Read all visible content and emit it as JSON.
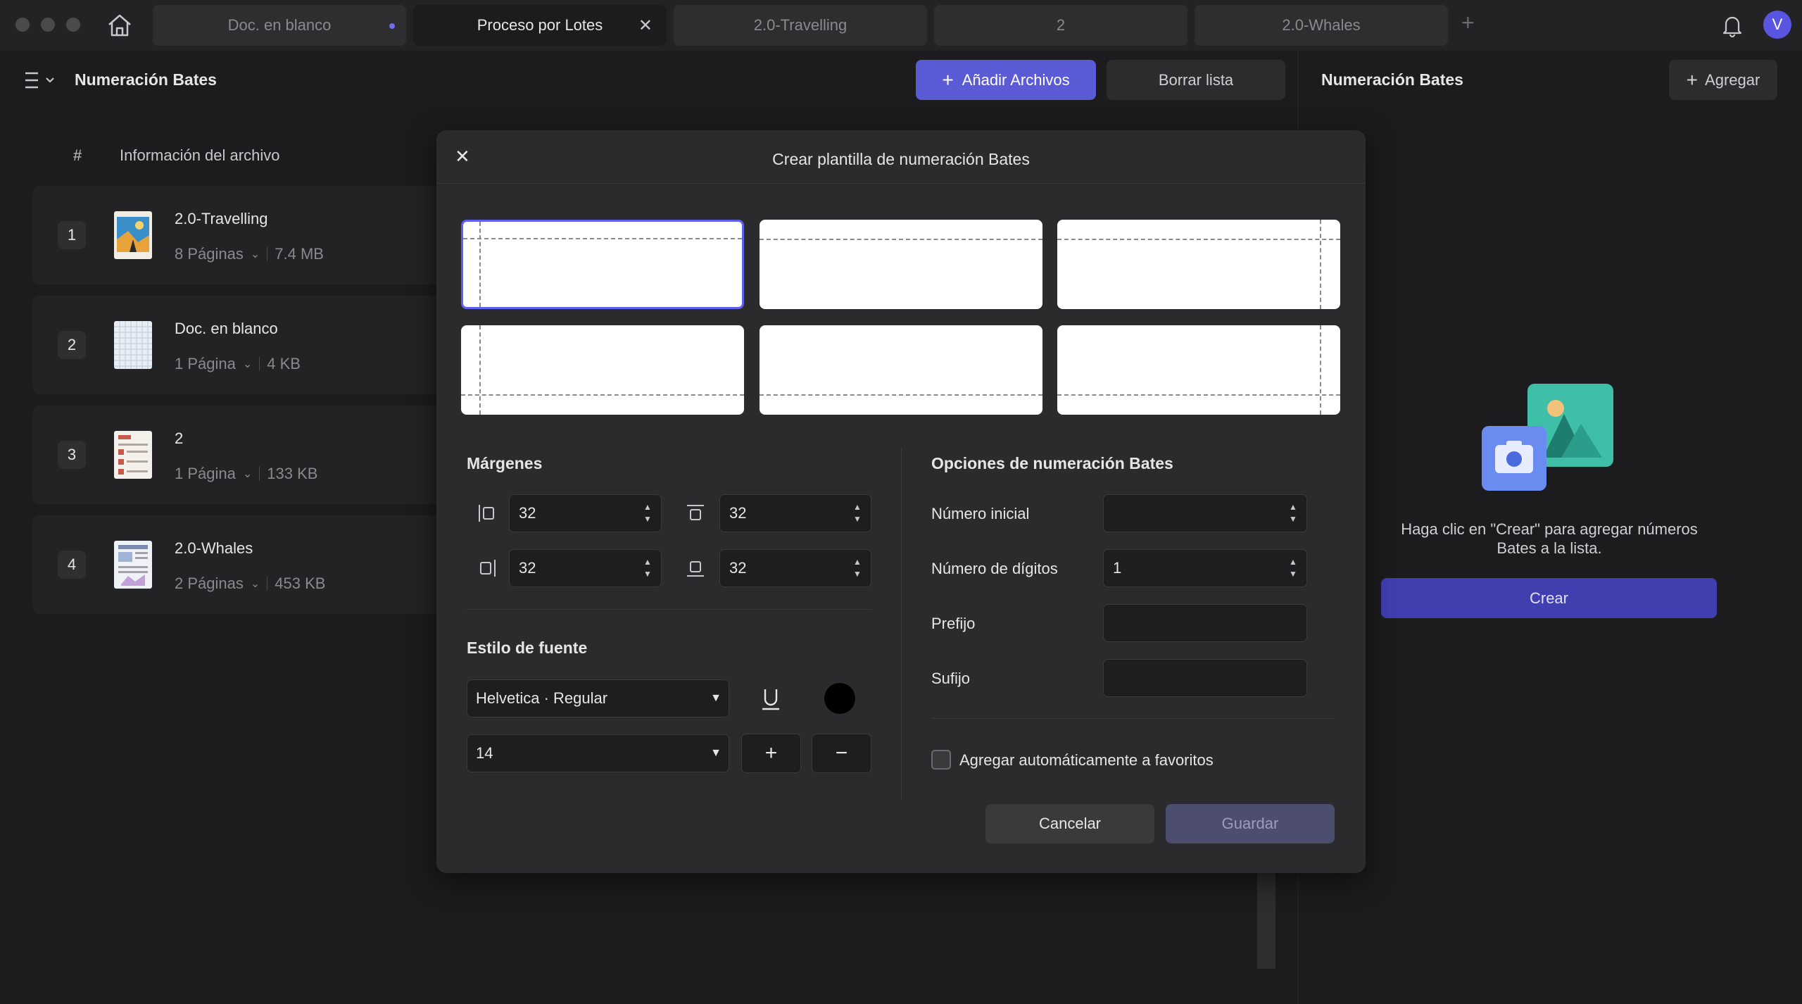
{
  "window": {
    "tabs": [
      {
        "label": "Doc. en blanco"
      },
      {
        "label": "Proceso por Lotes"
      },
      {
        "label": "2.0-Travelling"
      },
      {
        "label": "2"
      },
      {
        "label": "2.0-Whales"
      }
    ],
    "active_tab": "Proceso por Lotes",
    "avatar_letter": "V"
  },
  "left_panel": {
    "title": "Numeración Bates",
    "add_files_label": "Añadir Archivos",
    "clear_list_label": "Borrar lista",
    "col_number": "#",
    "col_info": "Información del archivo",
    "files": [
      {
        "num": "1",
        "name": "2.0-Travelling",
        "pages": "8 Páginas",
        "size": "7.4 MB"
      },
      {
        "num": "2",
        "name": "Doc. en blanco",
        "pages": "1 Página",
        "size": "4 KB"
      },
      {
        "num": "3",
        "name": "2",
        "pages": "1 Página",
        "size": "133 KB"
      },
      {
        "num": "4",
        "name": "2.0-Whales",
        "pages": "2 Páginas",
        "size": "453 KB"
      }
    ]
  },
  "right_panel": {
    "title": "Numeración Bates",
    "add_label": "Agregar",
    "hint": "Haga clic en \"Crear\" para agregar números Bates a la lista.",
    "create_label": "Crear"
  },
  "modal": {
    "title": "Crear plantilla de numeración Bates",
    "margins_title": "Márgenes",
    "margin_left": "32",
    "margin_top": "32",
    "margin_right": "32",
    "margin_bottom": "32",
    "font_title": "Estilo de fuente",
    "font_family": "Helvetica · Regular",
    "font_size": "14",
    "font_color": "#000000",
    "options_title": "Opciones de numeración Bates",
    "start_number_label": "Número inicial",
    "start_number_value": "",
    "digits_label": "Número de dígitos",
    "digits_value": "1",
    "prefix_label": "Prefijo",
    "prefix_value": "",
    "suffix_label": "Sufijo",
    "suffix_value": "",
    "favorites_label": "Agregar automáticamente a favoritos",
    "favorites_checked": false,
    "cancel_label": "Cancelar",
    "save_label": "Guardar"
  },
  "colors": {
    "accent": "#5b5bd6",
    "background": "#1c1c1e",
    "modal_bg": "#2b2b2d"
  }
}
